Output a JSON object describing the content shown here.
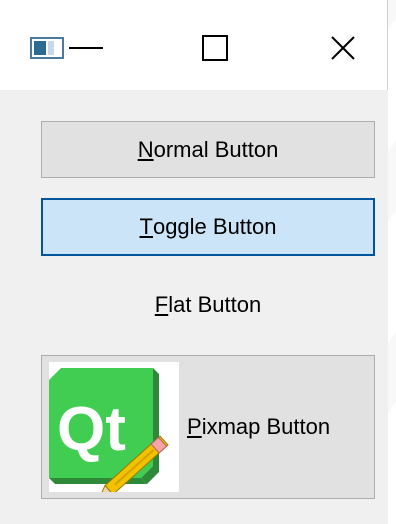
{
  "window": {
    "controls": {
      "minimize_icon": "minimize-icon",
      "maximize_icon": "maximize-icon",
      "close_icon": "close-icon"
    }
  },
  "buttons": {
    "normal": {
      "mnemonic": "N",
      "rest": "ormal Button"
    },
    "toggle": {
      "mnemonic": "T",
      "rest": "oggle Button"
    },
    "flat": {
      "mnemonic": "F",
      "rest": "lat Button"
    },
    "pixmap": {
      "mnemonic": "P",
      "rest": "ixmap Button",
      "image_logo_text": "Qt"
    }
  },
  "colors": {
    "toggle_bg": "#cce4f7",
    "toggle_border": "#005499",
    "button_bg": "#e1e1e1",
    "qt_green": "#3fa535"
  }
}
